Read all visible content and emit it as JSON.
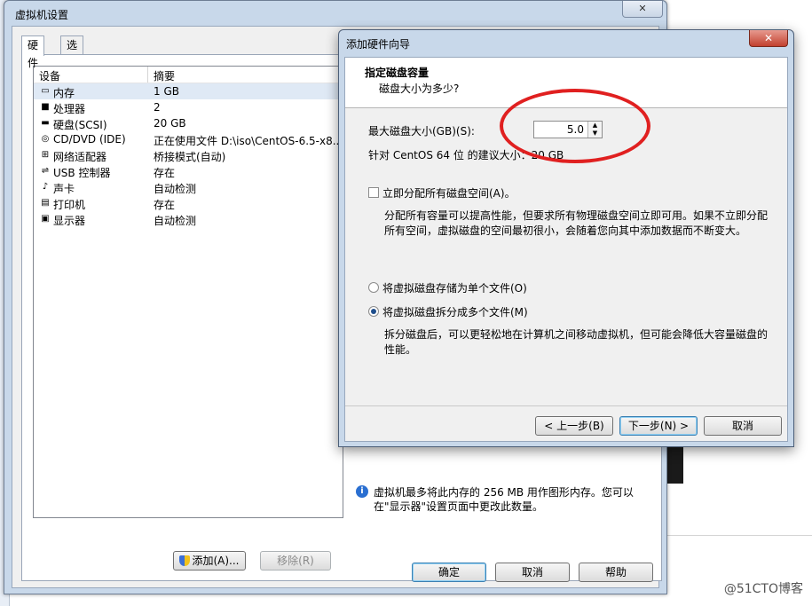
{
  "main_window": {
    "title": "虚拟机设置",
    "close_label": "✕",
    "tabs": [
      "硬件",
      "选项"
    ],
    "columns": {
      "device": "设备",
      "summary": "摘要"
    },
    "devices": [
      {
        "icon": "memory-icon",
        "glyph": "▭",
        "name": "内存",
        "summary": "1 GB"
      },
      {
        "icon": "processor-icon",
        "glyph": "■",
        "name": "处理器",
        "summary": "2"
      },
      {
        "icon": "harddisk-icon",
        "glyph": "▬",
        "name": "硬盘(SCSI)",
        "summary": "20 GB"
      },
      {
        "icon": "cdrom-icon",
        "glyph": "◎",
        "name": "CD/DVD (IDE)",
        "summary": "正在使用文件 D:\\iso\\CentOS-6.5-x8..."
      },
      {
        "icon": "network-icon",
        "glyph": "⊞",
        "name": "网络适配器",
        "summary": "桥接模式(自动)"
      },
      {
        "icon": "usb-icon",
        "glyph": "⇌",
        "name": "USB 控制器",
        "summary": "存在"
      },
      {
        "icon": "sound-icon",
        "glyph": "♪",
        "name": "声卡",
        "summary": "自动检测"
      },
      {
        "icon": "printer-icon",
        "glyph": "▤",
        "name": "打印机",
        "summary": "存在"
      },
      {
        "icon": "display-icon",
        "glyph": "▣",
        "name": "显示器",
        "summary": "自动检测"
      }
    ],
    "add_button": "添加(A)...",
    "remove_button": "移除(R)",
    "info_text_1": "虚拟机最多将此内存的 256 MB 用作图形内存。您可以",
    "info_text_2": "在\"显示器\"设置页面中更改此数量。",
    "ok_button": "确定",
    "cancel_button": "取消",
    "help_button": "帮助"
  },
  "wizard": {
    "title": "添加硬件向导",
    "close_label": "✕",
    "heading": "指定磁盘容量",
    "subheading": "磁盘大小为多少?",
    "max_size_label": "最大磁盘大小(GB)(S):",
    "max_size_value": "5.0",
    "recommend_text": "针对 CentOS 64 位 的建议大小：20 GB",
    "allocate_all_label": "立即分配所有磁盘空间(A)。",
    "allocate_all_checked": false,
    "allocate_desc_1": "分配所有容量可以提高性能，但要求所有物理磁盘空间立即可用。如果不立即分配",
    "allocate_desc_2": "所有空间，虚拟磁盘的空间最初很小，会随着您向其中添加数据而不断变大。",
    "single_file_label": "将虚拟磁盘存储为单个文件(O)",
    "multi_file_label": "将虚拟磁盘拆分成多个文件(M)",
    "selected_option": "multi_file",
    "multi_desc_1": "拆分磁盘后，可以更轻松地在计算机之间移动虚拟机，但可能会降低大容量磁盘的",
    "multi_desc_2": "性能。",
    "back_button": "< 上一步(B)",
    "next_button": "下一步(N) >",
    "cancel_button": "取消"
  },
  "watermark": "@51CTO博客",
  "colors": {
    "annotation": "#e02020",
    "titlebar": "#c8d8ea"
  }
}
